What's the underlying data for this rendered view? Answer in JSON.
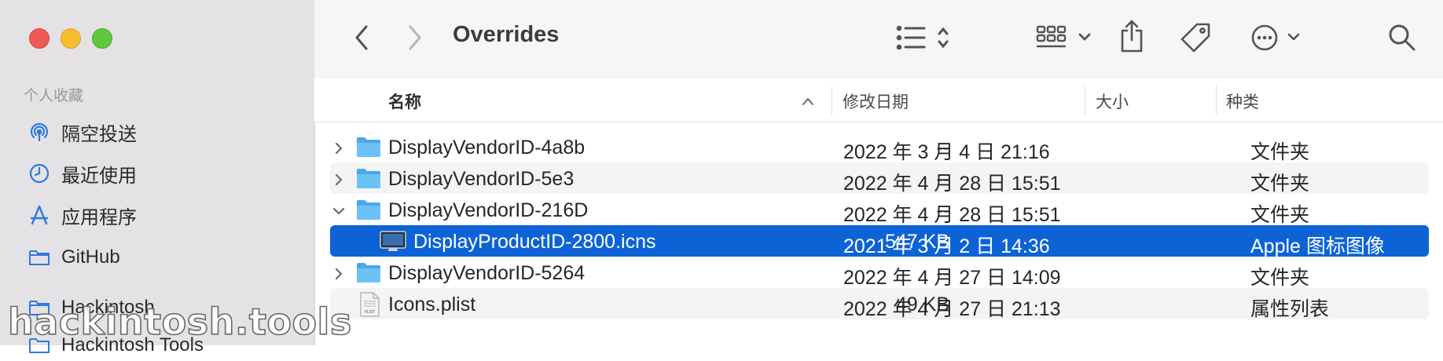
{
  "window": {
    "title": "Overrides"
  },
  "sidebar": {
    "section_label": "个人收藏",
    "items": [
      {
        "label": "隔空投送",
        "icon": "airdrop-icon"
      },
      {
        "label": "最近使用",
        "icon": "clock-icon"
      },
      {
        "label": "应用程序",
        "icon": "applications-icon"
      },
      {
        "label": "GitHub",
        "icon": "folder-icon"
      },
      {
        "label": "Hackintosh",
        "icon": "folder-icon"
      },
      {
        "label": "Hackintosh Tools",
        "icon": "folder-icon"
      }
    ]
  },
  "toolbar": {
    "back": "chevron-left-icon",
    "forward": "chevron-right-icon",
    "view_list": "list-view-icon",
    "group": "grid-group-icon",
    "share": "share-icon",
    "tag": "tag-icon",
    "more": "ellipsis-circle-icon",
    "search": "search-icon"
  },
  "columns": {
    "name": "名称",
    "date": "修改日期",
    "size": "大小",
    "kind": "种类"
  },
  "files": [
    {
      "name": "DisplayVendorID-4a8b",
      "date": "2022 年 3 月 4 日 21:16",
      "size": "--",
      "kind": "文件夹",
      "type": "folder",
      "expanded": false
    },
    {
      "name": "DisplayVendorID-5e3",
      "date": "2022 年 4 月 28 日 15:51",
      "size": "--",
      "kind": "文件夹",
      "type": "folder",
      "expanded": false
    },
    {
      "name": "DisplayVendorID-216D",
      "date": "2022 年 4 月 28 日 15:51",
      "size": "--",
      "kind": "文件夹",
      "type": "folder",
      "expanded": true
    },
    {
      "name": "DisplayProductID-2800.icns",
      "date": "2021 年 3 月 2 日 14:36",
      "size": "547 KB",
      "kind": "Apple 图标图像",
      "type": "icns",
      "selected": true
    },
    {
      "name": "DisplayVendorID-5264",
      "date": "2022 年 4 月 27 日 14:09",
      "size": "--",
      "kind": "文件夹",
      "type": "folder",
      "expanded": false
    },
    {
      "name": "Icons.plist",
      "date": "2022 年 4 月 27 日 21:13",
      "size": "49 KB",
      "kind": "属性列表",
      "type": "plist"
    }
  ],
  "watermark": "hackintosh.tools",
  "colors": {
    "selection": "#0d63d6",
    "folder": "#5ab6ef",
    "sidebar_icon": "#2d7ae0"
  }
}
